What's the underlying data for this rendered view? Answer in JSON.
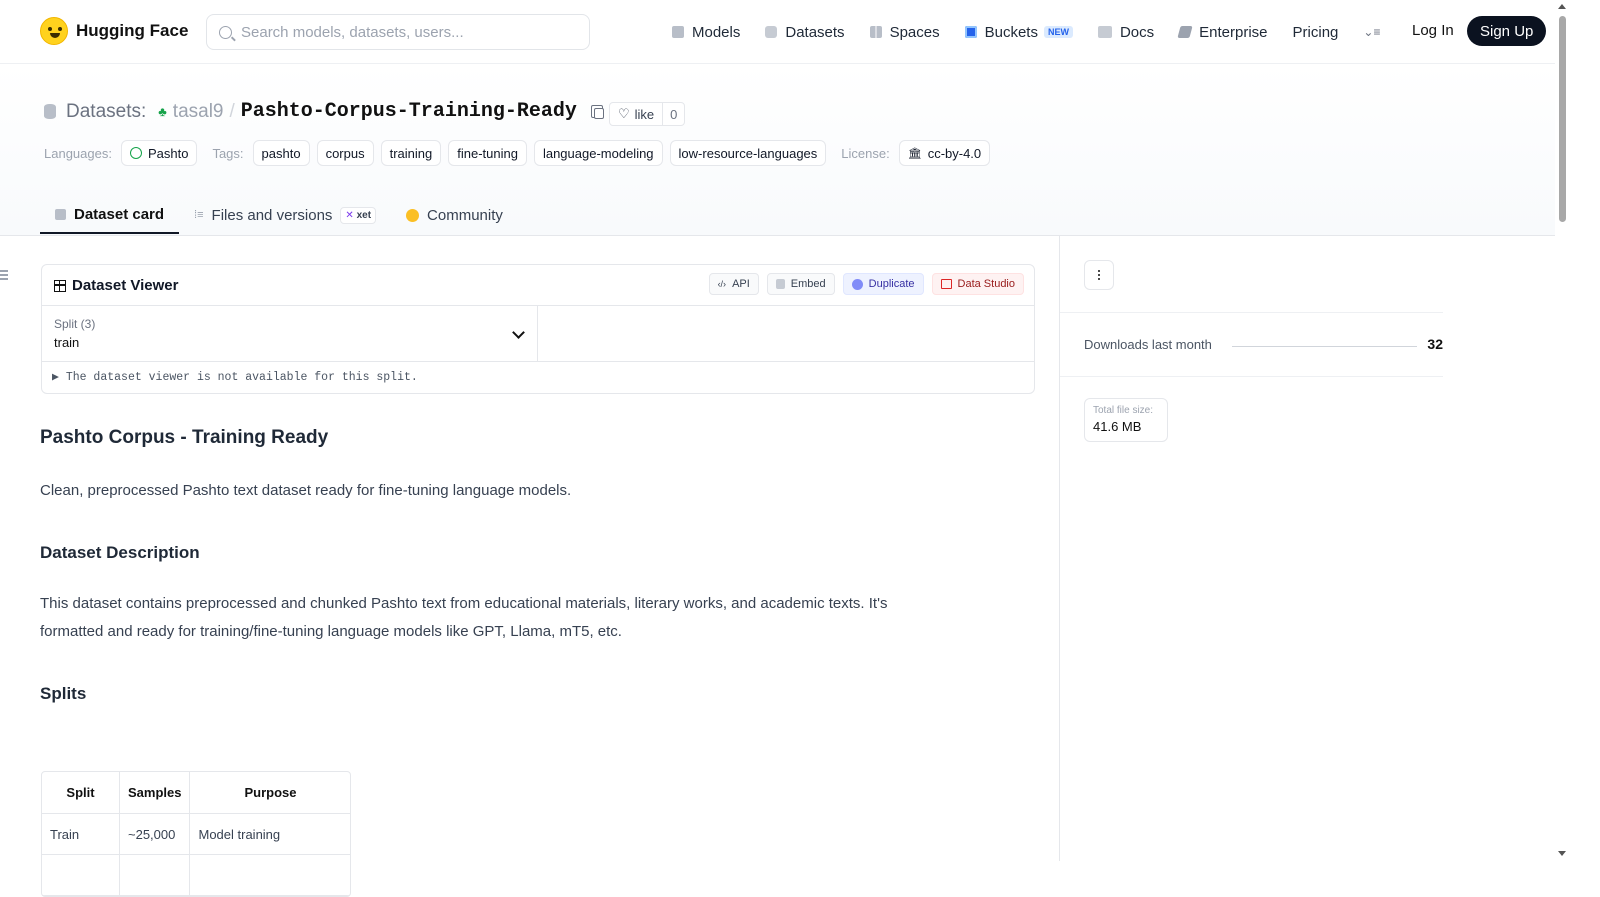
{
  "nav": {
    "brand": "Hugging Face",
    "search_placeholder": "Search models, datasets, users...",
    "links": [
      {
        "label": "Models",
        "icon": "cube-icon"
      },
      {
        "label": "Datasets",
        "icon": "database-icon"
      },
      {
        "label": "Spaces",
        "icon": "grid-icon"
      },
      {
        "label": "Buckets",
        "icon": "bucket-icon",
        "badge": "NEW"
      },
      {
        "label": "Docs",
        "icon": "book-icon"
      },
      {
        "label": "Enterprise",
        "icon": "enterprise-icon"
      },
      {
        "label": "Pricing"
      }
    ],
    "login": "Log In",
    "signup": "Sign Up"
  },
  "repo": {
    "section": "Datasets:",
    "user": "tasal9",
    "separator": "/",
    "name": "Pashto-Corpus-Training-Ready",
    "like_label": "like",
    "like_count": "0"
  },
  "meta": {
    "languages_label": "Languages:",
    "language": "Pashto",
    "tags_label": "Tags:",
    "tags": [
      "pashto",
      "corpus",
      "training",
      "fine-tuning",
      "language-modeling",
      "low-resource-languages"
    ],
    "license_label": "License:",
    "license": "cc-by-4.0"
  },
  "tabs": [
    {
      "label": "Dataset card",
      "active": true
    },
    {
      "label": "Files and versions",
      "badge": "xet"
    },
    {
      "label": "Community"
    }
  ],
  "viewer": {
    "title": "Dataset Viewer",
    "actions": [
      "API",
      "Embed",
      "Duplicate",
      "Data Studio"
    ],
    "split_label": "Split (3)",
    "split_value": "train",
    "unavailable": "The dataset viewer is not available for this split."
  },
  "card": {
    "title": "Pashto Corpus - Training Ready",
    "intro": "Clean, preprocessed Pashto text dataset ready for fine-tuning language models.",
    "desc_heading": "Dataset Description",
    "desc_line1": "This dataset contains preprocessed and chunked Pashto text from educational materials, literary works, and academic texts. It's",
    "desc_line2": "formatted and ready for training/fine-tuning language models like GPT, Llama, mT5, etc.",
    "splits_heading": "Splits",
    "table": {
      "headers": [
        "Split",
        "Samples",
        "Purpose"
      ],
      "rows": [
        [
          "Train",
          "~25,000",
          "Model training"
        ]
      ]
    }
  },
  "sidebar": {
    "downloads_label": "Downloads last month",
    "downloads_value": "32",
    "size_label": "Total file size:",
    "size_value": "41.6 MB"
  },
  "colors": {
    "accent_dark": "#0b1220",
    "brand_yellow": "#ffd21e",
    "buckets_blue": "#2563eb"
  }
}
